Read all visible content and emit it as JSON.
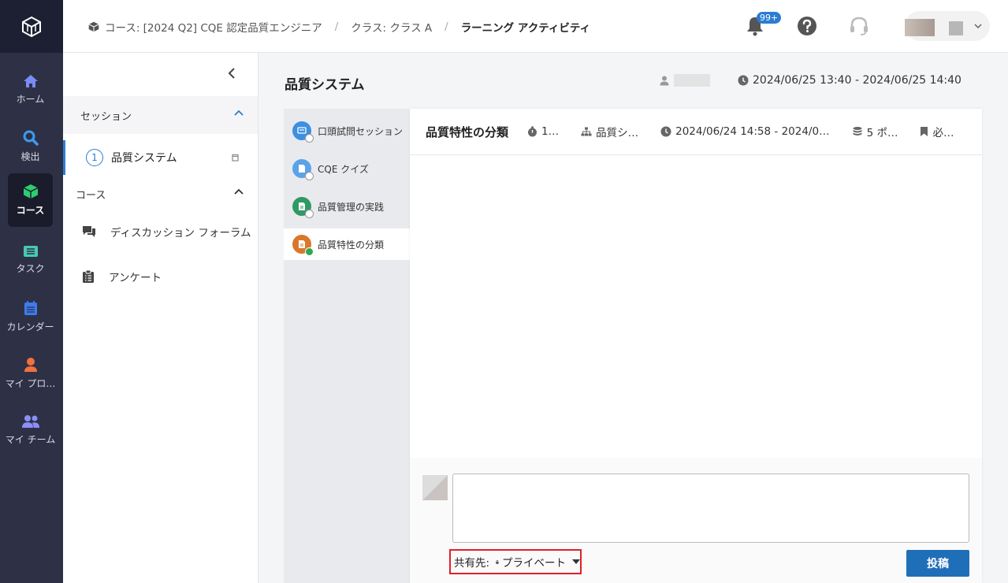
{
  "rail": {
    "items": [
      {
        "label": "ホーム"
      },
      {
        "label": "検出"
      },
      {
        "label": "コース"
      },
      {
        "label": "タスク"
      },
      {
        "label": "カレンダー"
      },
      {
        "label": "マイ プロ…"
      },
      {
        "label": "マイ チーム"
      }
    ]
  },
  "header": {
    "breadcrumb": [
      "コース: [2024 Q2] CQE 認定品質エンジニア",
      "クラス: クラス A",
      "ラーニング アクティビティ"
    ],
    "separator": "/",
    "notification_badge": "99+"
  },
  "sidebar": {
    "session_header": "セッション",
    "session_item": {
      "number": "1",
      "label": "品質システム"
    },
    "course_header": "コース",
    "links": [
      {
        "label": "ディスカッション フォーラム",
        "icon": "forum-icon"
      },
      {
        "label": "アンケート",
        "icon": "survey-icon"
      }
    ]
  },
  "main": {
    "title": "品質システム",
    "time_range": "2024/06/25 13:40 - 2024/06/25 14:40"
  },
  "activities": [
    {
      "label": "口頭試問セッション",
      "color": "#3d8fe0",
      "status": "pending"
    },
    {
      "label": "CQE クイズ",
      "color": "#5aa3e8",
      "status": "pending"
    },
    {
      "label": "品質管理の実践",
      "color": "#2f9a63",
      "status": "pending"
    },
    {
      "label": "品質特性の分類",
      "color": "#d9772b",
      "status": "done"
    }
  ],
  "panel": {
    "title": "品質特性の分類",
    "meta": {
      "duration": "1…",
      "session": "品質シ…",
      "time": "2024/06/24 14:58 - 2024/0…",
      "points": "5 ポ…",
      "required": "必…"
    }
  },
  "composer": {
    "share_label": "共有先:",
    "share_value": "プライベート",
    "post_button": "投稿"
  },
  "colors": {
    "accent": "#2b7cd3",
    "rail_bg": "#2e3146",
    "post_button": "#1f6fb8",
    "highlight": "#e0202a"
  }
}
